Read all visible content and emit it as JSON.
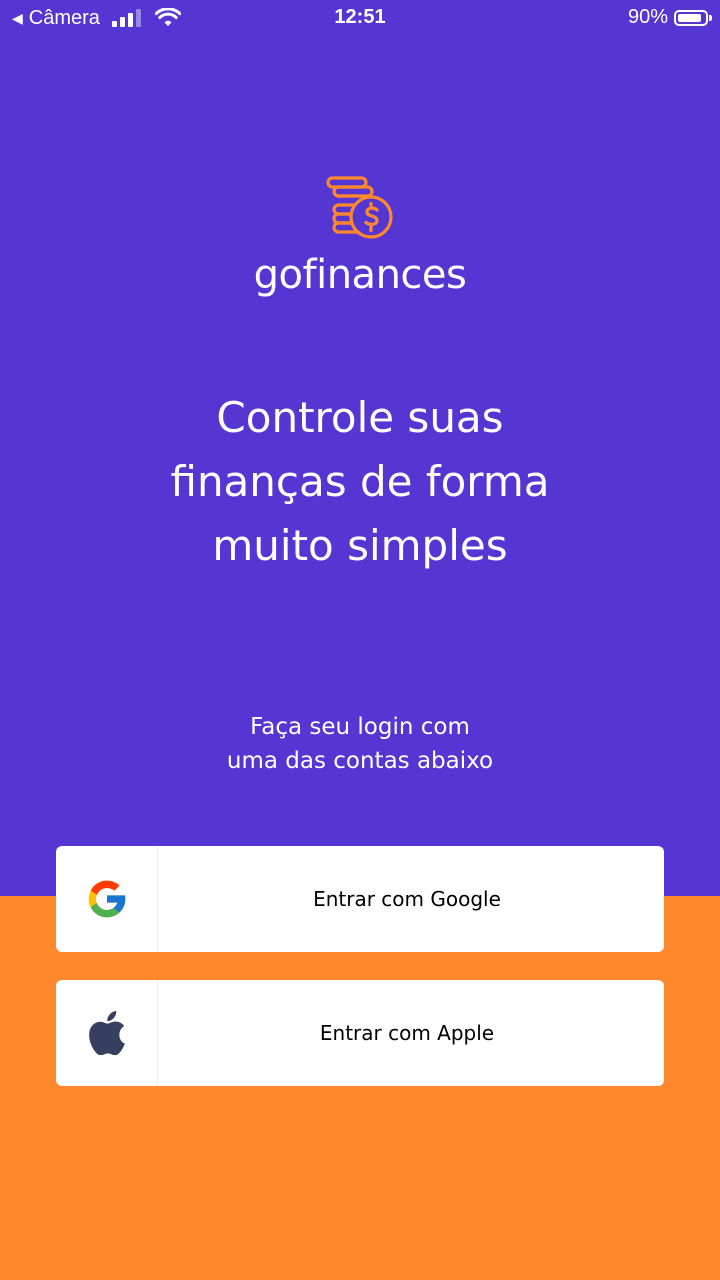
{
  "status_bar": {
    "back_label": "Câmera",
    "time": "12:51",
    "battery": "90%",
    "battery_level": 0.9
  },
  "brand": {
    "name": "gofinances",
    "logo_icon": "coins-dollar-icon"
  },
  "headline": {
    "line1": "Controle suas",
    "line2": "finanças de forma",
    "line3": "muito simples"
  },
  "subtitle": {
    "line1": "Faça seu login com",
    "line2": "uma das contas abaixo"
  },
  "buttons": {
    "google": {
      "label": "Entrar com Google",
      "icon": "google-icon"
    },
    "apple": {
      "label": "Entrar com Apple",
      "icon": "apple-icon"
    }
  },
  "colors": {
    "primary": "#5636D3",
    "secondary": "#FF872C",
    "button_bg": "#FFFFFF"
  }
}
